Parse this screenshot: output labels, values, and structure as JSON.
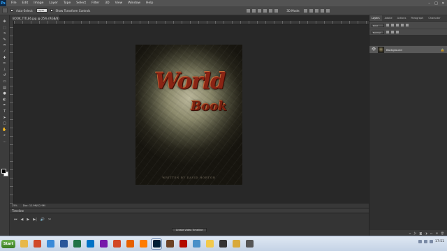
{
  "menubar": {
    "logo": "Ps",
    "items": [
      "File",
      "Edit",
      "Image",
      "Layer",
      "Type",
      "Select",
      "Filter",
      "3D",
      "View",
      "Window",
      "Help"
    ]
  },
  "options_bar": {
    "auto_select_label": "Auto-Select:",
    "auto_select_value": "Layer",
    "transform_label": "Show Transform Controls",
    "mode_label": "3D Mode:"
  },
  "document": {
    "tab_label": "BOOK_TITLE6.jpg @ 25% (RGB/8)",
    "title_line1": "World",
    "title_line2": "Book",
    "byline": "WRITTEN BY DAVID HORTON"
  },
  "status_bar": {
    "zoom": "25%",
    "doc_info": "Doc: 12.9M/12.9M"
  },
  "timeline": {
    "header": "Timeline",
    "create_button": "Create Video Timeline",
    "controls": [
      "⏮",
      "◀",
      "▶",
      "▶|",
      "🔊",
      "✂"
    ]
  },
  "layers_panel": {
    "tabs": [
      "Layers",
      "Adobe",
      "Actions",
      "Paragraph",
      "Character"
    ],
    "active_tab": "Layers",
    "filter_kind": "Kind",
    "blend_mode": "Normal",
    "layer": {
      "name": "Background",
      "visible": true,
      "locked": true
    }
  },
  "taskbar": {
    "start_label": "Start",
    "apps": [
      {
        "name": "explorer-icon",
        "color": "#e8b84a"
      },
      {
        "name": "media-icon",
        "color": "#d04a2a"
      },
      {
        "name": "chrome-icon",
        "color": "#3a8ad8"
      },
      {
        "name": "word-icon",
        "color": "#2b579a"
      },
      {
        "name": "excel-icon",
        "color": "#217346"
      },
      {
        "name": "outlook-icon",
        "color": "#0072c6"
      },
      {
        "name": "onenote-icon",
        "color": "#7719aa"
      },
      {
        "name": "powerpoint-icon",
        "color": "#d24726"
      },
      {
        "name": "firefox-icon",
        "color": "#e66000"
      },
      {
        "name": "illustrator-icon",
        "color": "#ff7c00"
      },
      {
        "name": "photoshop-icon",
        "color": "#001e36"
      },
      {
        "name": "bridge-icon",
        "color": "#6b4226"
      },
      {
        "name": "acrobat-icon",
        "color": "#b30b00"
      },
      {
        "name": "paint-icon",
        "color": "#4a90c8"
      },
      {
        "name": "notes-icon",
        "color": "#f2c94c"
      },
      {
        "name": "terminal-icon",
        "color": "#333333"
      },
      {
        "name": "folder-icon",
        "color": "#d9a93a"
      },
      {
        "name": "camera-icon",
        "color": "#555555"
      }
    ],
    "clock": "17:51"
  }
}
